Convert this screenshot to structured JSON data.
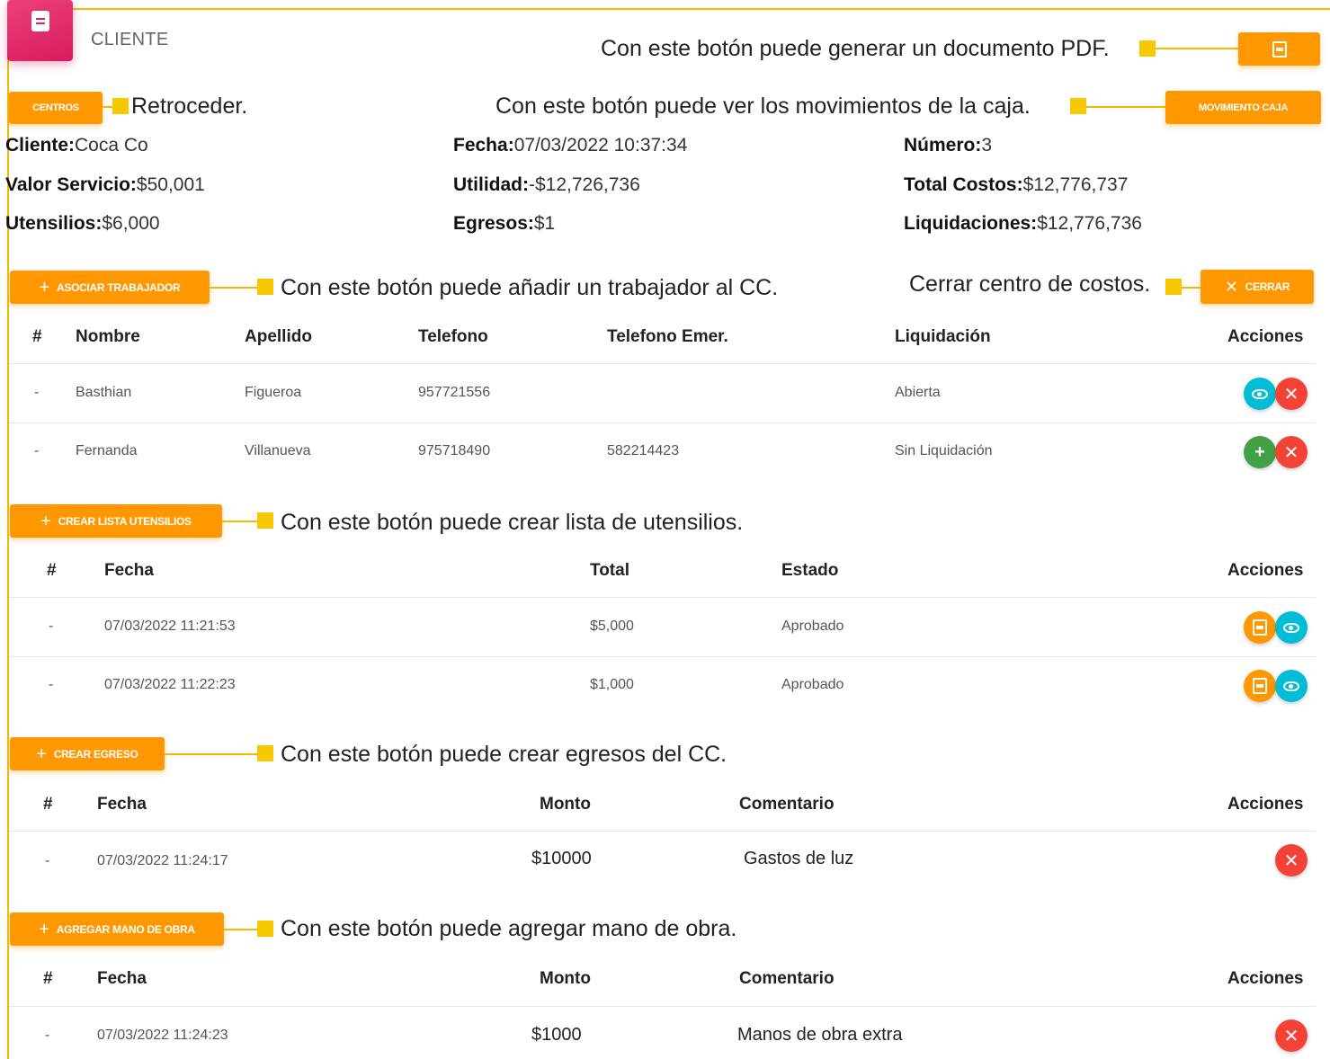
{
  "header": {
    "title": "CLIENTE",
    "icon": "document-icon",
    "icon_bg": "#e91e63"
  },
  "buttons": {
    "pdf": {
      "label": "",
      "icon": "pdf-icon"
    },
    "centros": "CENTROS",
    "movimiento_caja": "MOVIMIENTO CAJA",
    "asociar_trabajador": "ASOCIAR TRABAJADOR",
    "cerrar": "CERRAR",
    "crear_lista_utensilios": "CREAR LISTA UTENSILIOS",
    "crear_egreso": "CREAR EGRESO",
    "agregar_mano_obra": "AGREGAR MANO DE OBRA"
  },
  "annotations": {
    "pdf": "Con este botón puede generar un documento PDF.",
    "centros": "Retroceder.",
    "movimiento": "Con este botón puede ver los movimientos de la caja.",
    "asociar": "Con este botón puede añadir un trabajador al CC.",
    "cerrar": "Cerrar centro de costos.",
    "utensilios": "Con este botón puede crear lista de utensilios.",
    "egresos": "Con este botón puede crear egresos del CC.",
    "mano_obra": "Con este botón puede agregar mano de obra."
  },
  "info": {
    "cliente": {
      "label": "Cliente:",
      "value": "Coca Co"
    },
    "fecha": {
      "label": "Fecha:",
      "value": "07/03/2022 10:37:34"
    },
    "numero": {
      "label": "Número:",
      "value": "3"
    },
    "valor_servicio": {
      "label": "Valor Servicio:",
      "value": "$50,001"
    },
    "utilidad": {
      "label": "Utilidad:",
      "value": "-$12,726,736"
    },
    "total_costos": {
      "label": "Total Costos:",
      "value": "$12,776,737"
    },
    "utensilios": {
      "label": "Utensilios:",
      "value": "$6,000"
    },
    "egresos": {
      "label": "Egresos:",
      "value": "$1"
    },
    "liquidaciones": {
      "label": "Liquidaciones:",
      "value": "$12,776,736"
    }
  },
  "trabajadores": {
    "headers": [
      "#",
      "Nombre",
      "Apellido",
      "Telefono",
      "Telefono Emer.",
      "Liquidación",
      "Acciones"
    ],
    "rows": [
      {
        "num": "-",
        "nombre": "Basthian",
        "apellido": "Figueroa",
        "telefono": "957721556",
        "telefono_emer": "",
        "liquidacion": "Abierta",
        "actions": [
          "view",
          "delete"
        ]
      },
      {
        "num": "-",
        "nombre": "Fernanda",
        "apellido": "Villanueva",
        "telefono": "975718490",
        "telefono_emer": "582214423",
        "liquidacion": "Sin Liquidación",
        "actions": [
          "add",
          "delete"
        ]
      }
    ]
  },
  "utensilios": {
    "headers": [
      "#",
      "Fecha",
      "Total",
      "Estado",
      "Acciones"
    ],
    "rows": [
      {
        "num": "-",
        "fecha": "07/03/2022 11:21:53",
        "total": "$5,000",
        "estado": "Aprobado"
      },
      {
        "num": "-",
        "fecha": "07/03/2022 11:22:23",
        "total": "$1,000",
        "estado": "Aprobado"
      }
    ]
  },
  "egresos": {
    "headers": [
      "#",
      "Fecha",
      "Monto",
      "Comentario",
      "Acciones"
    ],
    "rows": [
      {
        "num": "-",
        "fecha": "07/03/2022 11:24:17",
        "monto": "$10000",
        "comentario": "Gastos de luz"
      }
    ]
  },
  "mano_obra": {
    "headers": [
      "#",
      "Fecha",
      "Monto",
      "Comentario",
      "Acciones"
    ],
    "rows": [
      {
        "num": "-",
        "fecha": "07/03/2022 11:24:23",
        "monto": "$1000",
        "comentario": "Manos de obra extra"
      }
    ]
  },
  "colors": {
    "accent": "#ff9800",
    "highlight": "#f5c800",
    "danger": "#f44336",
    "info": "#00bcd4",
    "success": "#43a047"
  }
}
